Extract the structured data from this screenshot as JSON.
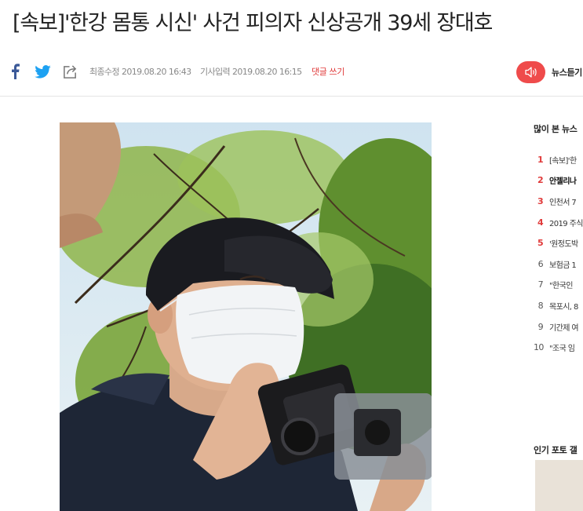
{
  "article": {
    "headline": "[속보]'한강 몸통 시신' 사건 피의자 신상공개 39세 장대호",
    "modified": "최종수정 2019.08.20 16:43",
    "registered": "기사입력 2019.08.20 16:15",
    "comment_link": "댓글 쓰기"
  },
  "listen": {
    "label": "뉴스듣기"
  },
  "sidebar": {
    "popular_title": "많이 본 뉴스",
    "items": [
      {
        "rank": "1",
        "text": "[속보]'한"
      },
      {
        "rank": "2",
        "text": "안젤리나"
      },
      {
        "rank": "3",
        "text": "인천서 7"
      },
      {
        "rank": "4",
        "text": "2019 주식"
      },
      {
        "rank": "5",
        "text": "'원정도박"
      },
      {
        "rank": "6",
        "text": "보험금 1"
      },
      {
        "rank": "7",
        "text": "\"한국인"
      },
      {
        "rank": "8",
        "text": "목포시, 8"
      },
      {
        "rank": "9",
        "text": "기간제 여"
      },
      {
        "rank": "10",
        "text": "\"조국 임"
      }
    ],
    "photo_title": "인기 포토 갤"
  },
  "colors": {
    "accent": "#e03a3a",
    "listen_button": "#ef4b4b",
    "twitter": "#1da1f2",
    "facebook": "#3b5998"
  },
  "icons": [
    "facebook-icon",
    "twitter-icon",
    "share-icon",
    "speaker-icon"
  ]
}
